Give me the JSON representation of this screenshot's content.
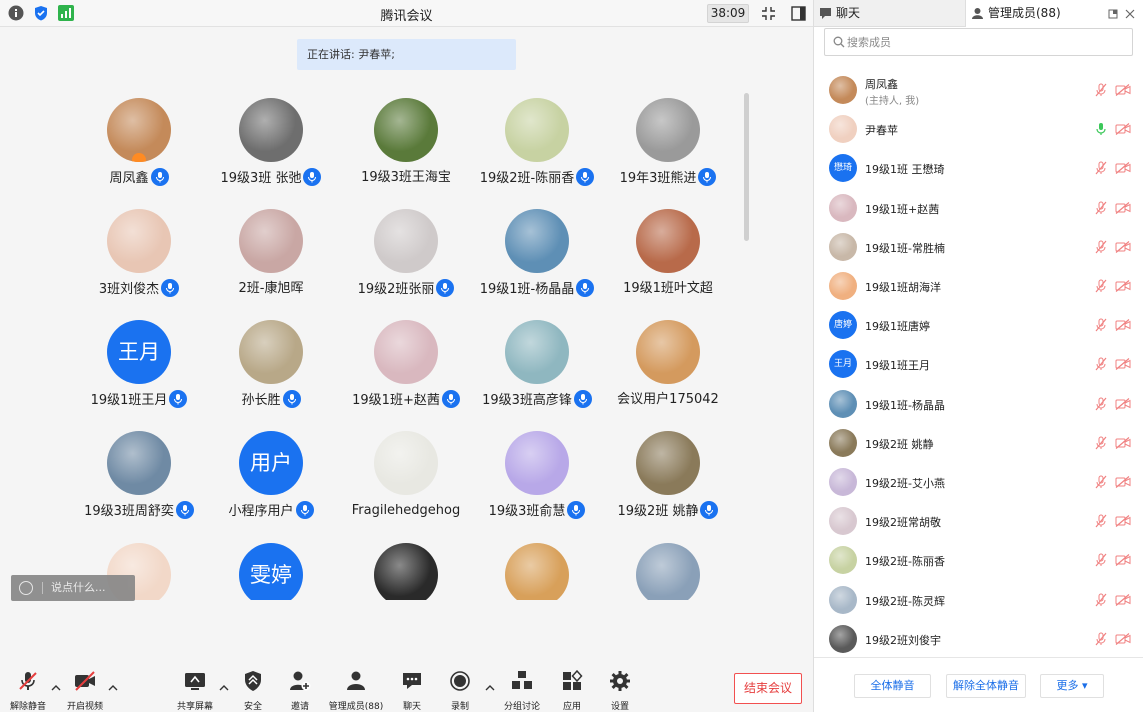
{
  "app": {
    "title": "腾讯会议",
    "timer": "38:09"
  },
  "speaker_banner": "正在讲话: 尹春苹;",
  "grid": [
    {
      "name": "周凤鑫",
      "avatar": "photo",
      "color": "#c48a5a",
      "mic": true,
      "host": true
    },
    {
      "name": "19级3班 张弛",
      "avatar": "photo",
      "color": "#6e6e6e",
      "mic": true
    },
    {
      "name": "19级3班王海宝",
      "avatar": "photo",
      "color": "#5a7a3a",
      "mic": false
    },
    {
      "name": "19级2班-陈丽香",
      "avatar": "photo",
      "color": "#c7d2a2",
      "mic": true
    },
    {
      "name": "19年3班熊进",
      "avatar": "photo",
      "color": "#9a9a9a",
      "mic": true
    },
    {
      "name": "3班刘俊杰",
      "avatar": "photo",
      "color": "#e8c6b4",
      "mic": true
    },
    {
      "name": "2班-康旭晖",
      "avatar": "photo",
      "color": "#c9a7a4",
      "mic": false
    },
    {
      "name": "19级2班张丽",
      "avatar": "photo",
      "color": "#cfcaca",
      "mic": true
    },
    {
      "name": "19级1班-杨晶晶",
      "avatar": "photo",
      "color": "#5e8fb5",
      "mic": true
    },
    {
      "name": "19级1班叶文超",
      "avatar": "photo",
      "color": "#b86a4a",
      "mic": false
    },
    {
      "name": "19级1班王月",
      "avatar": "text",
      "text": "王月",
      "mic": true
    },
    {
      "name": "孙长胜",
      "avatar": "photo",
      "color": "#b8a888",
      "mic": true
    },
    {
      "name": "19级1班+赵茜",
      "avatar": "photo",
      "color": "#d9b8bf",
      "mic": true
    },
    {
      "name": "19级3班高彦锋",
      "avatar": "photo",
      "color": "#8fb7c0",
      "mic": true
    },
    {
      "name": "会议用户175042",
      "avatar": "photo",
      "color": "#d49a5e",
      "mic": false
    },
    {
      "name": "19级3班周舒奕",
      "avatar": "photo",
      "color": "#6f8aa4",
      "mic": true
    },
    {
      "name": "小程序用户",
      "avatar": "text",
      "text": "用户",
      "mic": true
    },
    {
      "name": "Fragilehedgehog",
      "avatar": "photo",
      "color": "#e8e8e2",
      "mic": false
    },
    {
      "name": "19级3班俞慧",
      "avatar": "photo",
      "color": "#b8a8e8",
      "mic": true
    },
    {
      "name": "19级2班 姚静",
      "avatar": "photo",
      "color": "#8a7a5a",
      "mic": true
    },
    {
      "name": "",
      "avatar": "photo",
      "color": "#f2d8c8",
      "mic": false
    },
    {
      "name": "",
      "avatar": "text",
      "text": "雯婷",
      "mic": false
    },
    {
      "name": "",
      "avatar": "photo",
      "color": "#2a2a2a",
      "mic": false
    },
    {
      "name": "",
      "avatar": "photo",
      "color": "#d8a05a",
      "mic": false
    },
    {
      "name": "",
      "avatar": "photo",
      "color": "#8aa0b8",
      "mic": false
    }
  ],
  "chat_input": {
    "placeholder": "说点什么..."
  },
  "toolbar": {
    "unmute": "解除静音",
    "start_video": "开启视频",
    "share": "共享屏幕",
    "security": "安全",
    "invite": "邀请",
    "members": "管理成员(88)",
    "chat": "聊天",
    "record": "录制",
    "breakout": "分组讨论",
    "apps": "应用",
    "settings": "设置",
    "end": "结束会议"
  },
  "panel": {
    "tab_chat": "聊天",
    "tab_members": "管理成员(88)",
    "search_placeholder": "搜索成员",
    "members": [
      {
        "name": "周凤鑫",
        "sub": "(主持人, 我)",
        "avatar": "photo",
        "color": "#c48a5a",
        "speaking": false
      },
      {
        "name": "尹春苹",
        "avatar": "photo",
        "color": "#f0d0c0",
        "speaking": true
      },
      {
        "name": "19级1班 王懋琦",
        "avatar": "text",
        "text": "懋琦",
        "speaking": false
      },
      {
        "name": "19级1班+赵茜",
        "avatar": "photo",
        "color": "#d9b8bf",
        "speaking": false
      },
      {
        "name": "19级1班-常胜楠",
        "avatar": "photo",
        "color": "#c8b8a8",
        "speaking": false
      },
      {
        "name": "19级1班胡海洋",
        "avatar": "photo",
        "color": "#f0b080",
        "speaking": false
      },
      {
        "name": "19级1班唐婷",
        "avatar": "text",
        "text": "唐婷",
        "speaking": false
      },
      {
        "name": "19级1班王月",
        "avatar": "text",
        "text": "王月",
        "speaking": false
      },
      {
        "name": "19级1班-杨晶晶",
        "avatar": "photo",
        "color": "#5e8fb5",
        "speaking": false
      },
      {
        "name": "19级2班 姚静",
        "avatar": "photo",
        "color": "#8a7a5a",
        "speaking": false
      },
      {
        "name": "19级2班-艾小燕",
        "avatar": "photo",
        "color": "#c8b8d8",
        "speaking": false
      },
      {
        "name": "19级2班常胡敬",
        "avatar": "photo",
        "color": "#d8c8d0",
        "speaking": false
      },
      {
        "name": "19级2班-陈丽香",
        "avatar": "photo",
        "color": "#c7d2a2",
        "speaking": false
      },
      {
        "name": "19级2班-陈灵辉",
        "avatar": "photo",
        "color": "#a8b8c8",
        "speaking": false
      },
      {
        "name": "19级2班刘俊宇",
        "avatar": "photo",
        "color": "#5a5a5a",
        "speaking": false
      }
    ],
    "footer": {
      "mute_all": "全体静音",
      "unmute_all": "解除全体静音",
      "more": "更多 ▾"
    }
  },
  "colors": {
    "accent": "#1a72f0",
    "danger": "#e63e3e",
    "muted_icon": "#f08080",
    "speaking": "#3cc85a"
  }
}
